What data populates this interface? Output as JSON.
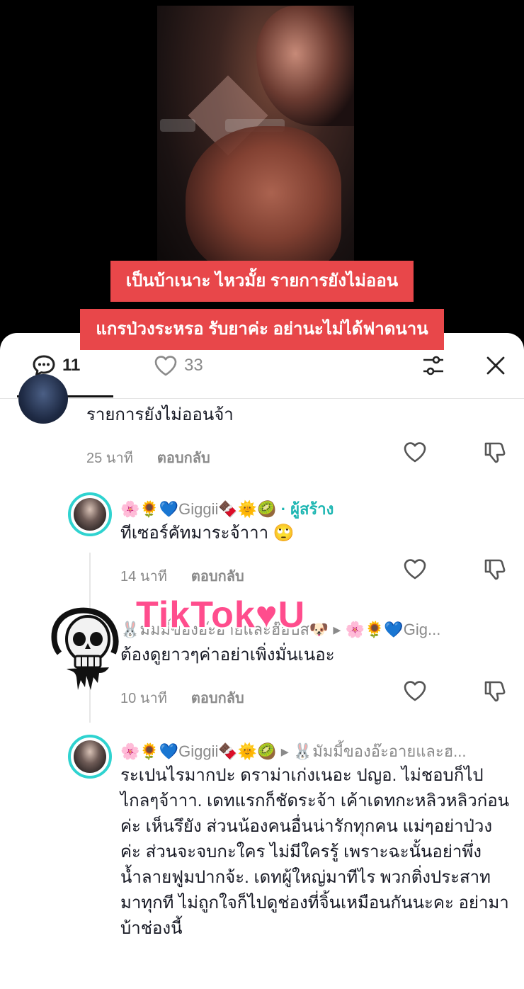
{
  "caption": {
    "line1": "เป็นบ้าเนาะ ไหวมั้ย รายการยังไม่ออน",
    "line2": "แกรป่วงระหรอ รับยาค่ะ อย่านะไม่ได้ฟาดนาน"
  },
  "sheet": {
    "comment_count": "11",
    "like_count": "33"
  },
  "comments": [
    {
      "text": "รายการยังไม่ออนจ้า",
      "time": "25 นาที",
      "reply": "ตอบกลับ"
    },
    {
      "author": "🌸🌻💙Giggii🍫🌞🥝",
      "creator_label": "· ผู้สร้าง",
      "text": "ทีเซอร์คัทมาระจ้าาา 🙄",
      "time": "14 นาที",
      "reply": "ตอบกลับ"
    },
    {
      "author": "🐰มัมมี้ของอ๊ะอายและฮ๊อบัส🐶 ▸ 🌸🌻💙Gig...",
      "text": "ต้องดูยาวๆค่าอย่าเพิ่งมั่นเนอะ",
      "time": "10 นาที",
      "reply": "ตอบกลับ"
    },
    {
      "author": "🌸🌻💙Giggii🍫🌞🥝 ▸ 🐰มัมมี้ของอ๊ะอายและฮ...",
      "text": "ระเปนไรมากปะ ดราม่าเก่งเนอะ ปญอ. ไม่ชอบก็ไปไกลๆจ้าาา. เดทแรกก็ชัดระจ้า เค้าเดทกะหลิวหลิวก่อนค่ะ เห็นรึยัง ส่วนน้องคนอื่นน่ารักทุกคน แม่ๆอย่าป่วงค่ะ ส่วนจะจบกะใคร ไม่มีใครรู้ เพราะฉะนั้นอย่าพึ่งน้ำลายฟูมปากจ้ะ. เดทผู้ใหญ่มาทีไร พวกติ่งประสาทมาทุกที ไม่ถูกใจก็ไปดูช่องที่จิ้นเหมือนกันนะคะ อย่ามาบ้าช่องนี้"
    }
  ],
  "watermark": "TikTok♥U",
  "colors": {
    "caption_bg": "#e8474a",
    "creator_tag": "#1db6b2",
    "avatar_ring": "#2fd3d0",
    "watermark": "#ff4d8d"
  }
}
